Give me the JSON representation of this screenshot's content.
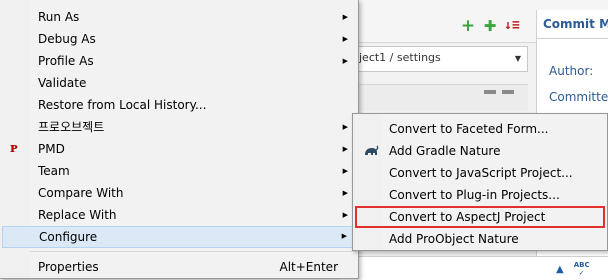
{
  "background": {
    "commit_tab_title": "Commit Me",
    "author_label": "Author:",
    "committer_label": "Committer",
    "path_field_text": "ject1 / settings",
    "abc_label": "ABC"
  },
  "main_menu": {
    "items": [
      {
        "label": "Run As",
        "submenu": true
      },
      {
        "label": "Debug As",
        "submenu": true
      },
      {
        "label": "Profile As",
        "submenu": true
      },
      {
        "label": "Validate",
        "submenu": false
      },
      {
        "label": "Restore from Local History...",
        "submenu": false
      },
      {
        "label": "프로오브젝트",
        "submenu": true
      },
      {
        "label": "PMD",
        "submenu": true,
        "icon": "pmd-icon"
      },
      {
        "label": "Team",
        "submenu": true
      },
      {
        "label": "Compare With",
        "submenu": true
      },
      {
        "label": "Replace With",
        "submenu": true
      },
      {
        "label": "Configure",
        "submenu": true,
        "highlighted": true
      }
    ],
    "properties": {
      "label": "Properties",
      "shortcut": "Alt+Enter"
    }
  },
  "configure_submenu": {
    "items": [
      {
        "label": "Convert to Faceted Form..."
      },
      {
        "label": "Add Gradle Nature",
        "icon": "gradle-elephant-icon"
      },
      {
        "label": "Convert to JavaScript Project..."
      },
      {
        "label": "Convert to Plug-in Projects..."
      },
      {
        "label": "Convert to AspectJ Project",
        "selected": true
      },
      {
        "label": "Add ProObject Nature"
      }
    ]
  },
  "colors": {
    "menu_bg": "#f2f2f2",
    "highlight": "#dbe9f7",
    "selection_outline": "#e03030",
    "commit_title": "#2b5c95"
  }
}
